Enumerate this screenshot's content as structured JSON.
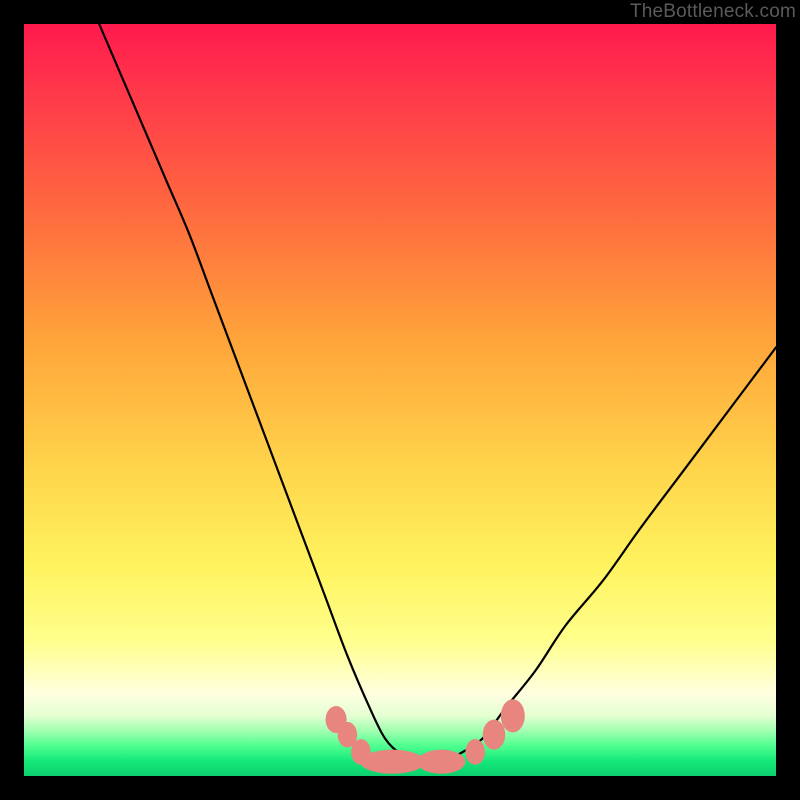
{
  "attribution": "TheBottleneck.com",
  "colors": {
    "frame": "#000000",
    "gradient_top": "#ff1a4d",
    "gradient_mid": "#ffd24a",
    "gradient_bottom": "#0ccf6f",
    "curve": "#000000",
    "marker": "#e9857f"
  },
  "chart_data": {
    "type": "line",
    "title": "",
    "xlabel": "",
    "ylabel": "",
    "xlim": [
      0,
      100
    ],
    "ylim": [
      0,
      100
    ],
    "series": [
      {
        "name": "bottleneck-curve",
        "x": [
          10,
          13,
          16,
          19,
          22,
          25,
          28,
          31,
          34,
          37,
          40,
          43,
          46,
          48,
          50,
          52,
          54,
          56,
          58,
          61,
          64,
          68,
          72,
          77,
          82,
          88,
          94,
          100
        ],
        "values": [
          100,
          93,
          86,
          79,
          72,
          64,
          56,
          48,
          40,
          32,
          24,
          16,
          9,
          5,
          3,
          2,
          2,
          2,
          3,
          5,
          9,
          14,
          20,
          26,
          33,
          41,
          49,
          57
        ]
      }
    ],
    "markers": [
      {
        "x": 41.5,
        "y": 7.5,
        "rx": 1.4,
        "ry": 1.8
      },
      {
        "x": 43.0,
        "y": 5.5,
        "rx": 1.3,
        "ry": 1.7
      },
      {
        "x": 44.8,
        "y": 3.2,
        "rx": 1.3,
        "ry": 1.7
      },
      {
        "x": 49.0,
        "y": 1.9,
        "rx": 4.3,
        "ry": 1.6
      },
      {
        "x": 55.5,
        "y": 1.9,
        "rx": 3.2,
        "ry": 1.6
      },
      {
        "x": 60.0,
        "y": 3.2,
        "rx": 1.3,
        "ry": 1.7
      },
      {
        "x": 62.5,
        "y": 5.5,
        "rx": 1.5,
        "ry": 2.0
      },
      {
        "x": 65.0,
        "y": 8.0,
        "rx": 1.6,
        "ry": 2.2
      }
    ]
  }
}
